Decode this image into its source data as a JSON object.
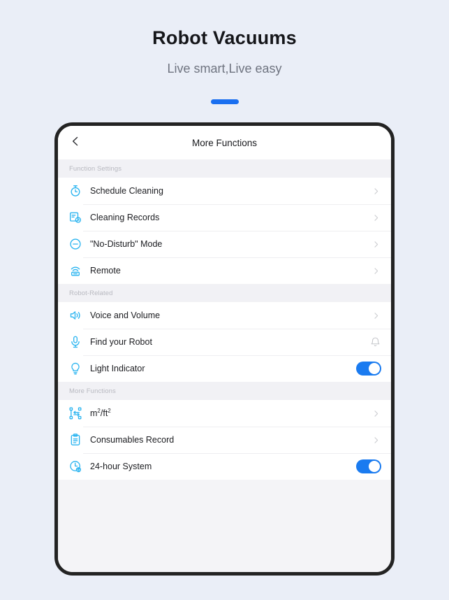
{
  "page": {
    "title": "Robot Vacuums",
    "subtitle": "Live smart,Live easy",
    "accent_color": "#1a6ff0",
    "background_color": "#eaeef7"
  },
  "app": {
    "nav": {
      "back_icon": "chevron-left-icon",
      "title": "More Functions"
    },
    "icon_color": "#2ab4f0",
    "toggle_on_color": "#1a7bf0",
    "sections": [
      {
        "header": "Function Settings",
        "items": [
          {
            "label": "Schedule Cleaning",
            "icon": "stopwatch-icon",
            "control": "chevron"
          },
          {
            "label": "Cleaning Records",
            "icon": "document-clock-icon",
            "control": "chevron"
          },
          {
            "label": "\"No-Disturb\" Mode",
            "icon": "do-not-disturb-icon",
            "control": "chevron"
          },
          {
            "label": "Remote",
            "icon": "remote-control-icon",
            "control": "chevron"
          }
        ]
      },
      {
        "header": "Robot-Related",
        "items": [
          {
            "label": "Voice and Volume",
            "icon": "speaker-volume-icon",
            "control": "chevron"
          },
          {
            "label": "Find your Robot",
            "icon": "microphone-icon",
            "control": "bell"
          },
          {
            "label": "Light Indicator",
            "icon": "lightbulb-icon",
            "control": "toggle",
            "toggle_state": "on"
          }
        ]
      },
      {
        "header": "More Functions",
        "items": [
          {
            "label": "m²/ft²",
            "icon": "area-units-icon",
            "control": "chevron"
          },
          {
            "label": "Consumables Record",
            "icon": "clipboard-icon",
            "control": "chevron"
          },
          {
            "label": "24-hour System",
            "icon": "clock-24-icon",
            "control": "toggle",
            "toggle_state": "on"
          }
        ]
      }
    ]
  }
}
